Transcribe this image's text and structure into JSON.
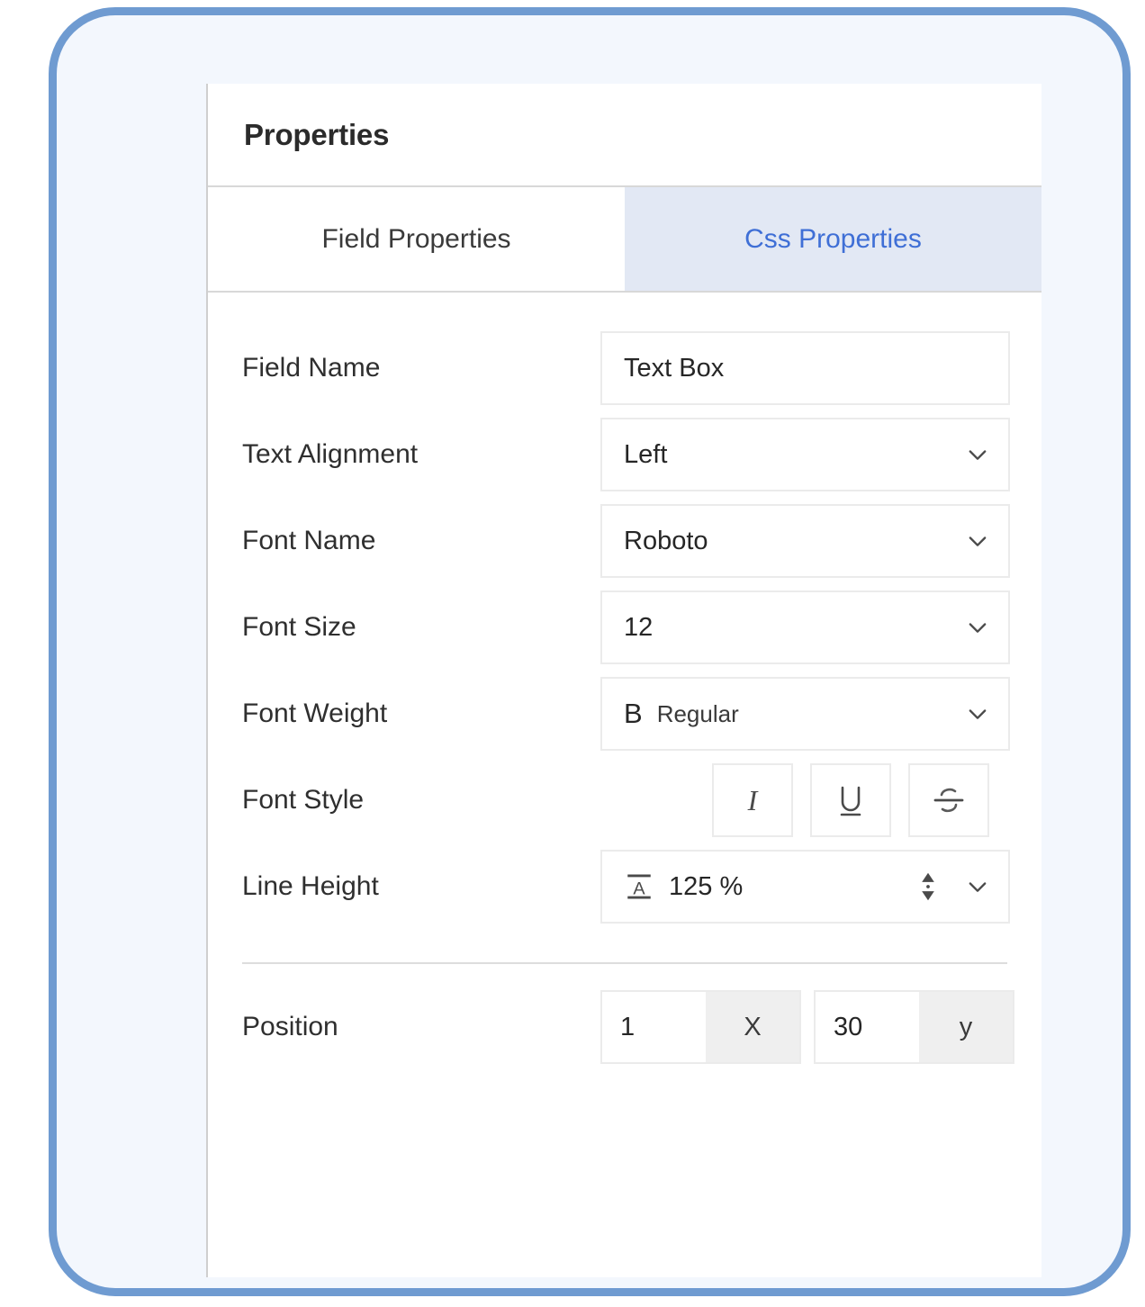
{
  "frame": {
    "border_color": "#6f9bd1",
    "background": "#f3f7fd"
  },
  "panel": {
    "title": "Properties",
    "accent_color": "#3f6fd6",
    "active_tab_bg": "#e2e8f4"
  },
  "tabs": [
    {
      "label": "Field Properties",
      "active": false
    },
    {
      "label": "Css Properties",
      "active": true
    }
  ],
  "fields": {
    "field_name": {
      "label": "Field Name",
      "value": "Text Box"
    },
    "text_alignment": {
      "label": "Text Alignment",
      "value": "Left"
    },
    "font_name": {
      "label": "Font Name",
      "value": "Roboto"
    },
    "font_size": {
      "label": "Font Size",
      "value": "12"
    },
    "font_weight": {
      "label": "Font Weight",
      "icon": "B",
      "value": "Regular"
    },
    "font_style": {
      "label": "Font Style",
      "buttons": [
        {
          "name": "italic",
          "glyph": "I"
        },
        {
          "name": "underline",
          "glyph": "U"
        },
        {
          "name": "strikethrough",
          "glyph": "S"
        }
      ]
    },
    "line_height": {
      "label": "Line Height",
      "value": "125 %"
    },
    "position": {
      "label": "Position",
      "x": {
        "value": "1",
        "suffix": "X"
      },
      "y": {
        "value": "30",
        "suffix": "y"
      }
    }
  },
  "icons": {
    "chevron_down": "chevron-down-icon",
    "stepper": "stepper-updown-icon",
    "line_height": "line-height-icon"
  }
}
